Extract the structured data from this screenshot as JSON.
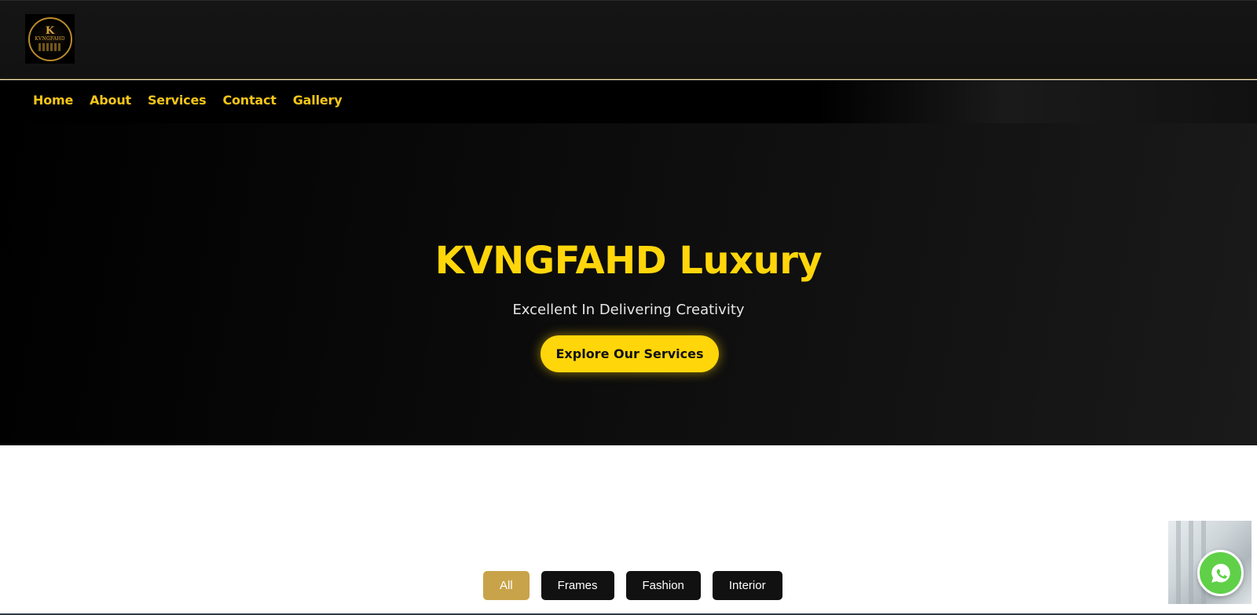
{
  "header": {
    "logo": {
      "icon": "kvngfahd-crest-logo",
      "k_glyph": "K",
      "text": "KVNGFAHD"
    }
  },
  "nav": {
    "items": [
      {
        "label": "Home"
      },
      {
        "label": "About"
      },
      {
        "label": "Services"
      },
      {
        "label": "Contact"
      },
      {
        "label": "Gallery"
      }
    ]
  },
  "hero": {
    "title": "KVNGFAHD Luxury",
    "subtitle": "Excellent In Delivering Creativity",
    "cta_label": "Explore Our Services"
  },
  "gallery": {
    "filters": [
      {
        "label": "All",
        "active": true
      },
      {
        "label": "Frames",
        "active": false
      },
      {
        "label": "Fashion",
        "active": false
      },
      {
        "label": "Interior",
        "active": false
      }
    ]
  },
  "floating": {
    "whatsapp_icon": "whatsapp-icon"
  },
  "colors": {
    "accent": "#ffd60a",
    "nav_text": "#f5c518",
    "filter_active": "#c9a349",
    "filter_inactive": "#111111",
    "whatsapp": "#5fd048"
  }
}
